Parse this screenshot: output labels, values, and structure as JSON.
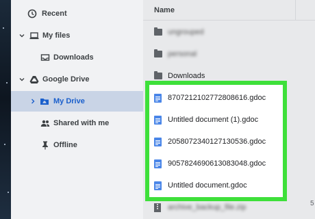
{
  "sidebar": {
    "items": [
      {
        "label": "Recent",
        "icon": "clock-icon"
      },
      {
        "label": "My files",
        "icon": "laptop-icon",
        "expand": "collapse"
      },
      {
        "label": "Downloads",
        "icon": "download-icon"
      },
      {
        "label": "Google Drive",
        "icon": "drive-icon",
        "expand": "collapse"
      },
      {
        "label": "My Drive",
        "icon": "drive-folder-icon",
        "expand": "expand",
        "selected": true
      },
      {
        "label": "Shared with me",
        "icon": "people-icon"
      },
      {
        "label": "Offline",
        "icon": "pin-icon"
      }
    ]
  },
  "main": {
    "column_header": "Name",
    "rows": [
      {
        "label": "ungrouped",
        "type": "folder",
        "blurred": true
      },
      {
        "label": "personal",
        "type": "folder",
        "blurred": true
      },
      {
        "label": "Downloads",
        "type": "folder"
      },
      {
        "label": "8707212102772808616.gdoc",
        "type": "gdoc"
      },
      {
        "label": "Untitled document (1).gdoc",
        "type": "gdoc"
      },
      {
        "label": "2058072340127130536.gdoc",
        "type": "gdoc"
      },
      {
        "label": "9057824690613083048.gdoc",
        "type": "gdoc"
      },
      {
        "label": "Untitled document.gdoc",
        "type": "gdoc"
      },
      {
        "label": "archive_backup_file.zip",
        "type": "zip",
        "blurred": true
      }
    ],
    "size_cell_partial": "5"
  },
  "colors": {
    "highlight_border": "#3ee03a",
    "selected_bg": "#c9d4e6",
    "accent": "#1a5fcc",
    "gdoc_blue": "#4a86e8"
  }
}
